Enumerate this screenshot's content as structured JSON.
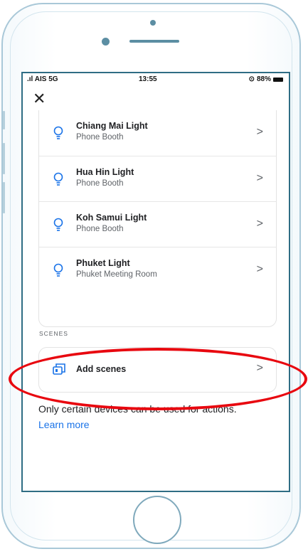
{
  "status_bar": {
    "carrier": ".ıl AIS 5G",
    "time": "13:55",
    "battery": "88%"
  },
  "header": {
    "close_glyph": "✕"
  },
  "devices": [
    {
      "name": "Chiang Mai Light",
      "room": "Phone Booth",
      "icon": "lightbulb-icon"
    },
    {
      "name": "Hua Hin Light",
      "room": "Phone Booth",
      "icon": "lightbulb-icon"
    },
    {
      "name": "Koh Samui Light",
      "room": "Phone Booth",
      "icon": "lightbulb-icon"
    },
    {
      "name": "Phuket Light",
      "room": "Phuket Meeting Room",
      "icon": "lightbulb-icon"
    }
  ],
  "scenes": {
    "section_label": "SCENES",
    "add_label": "Add scenes",
    "icon": "scenes-icon"
  },
  "chevron_glyph": ">",
  "footer": {
    "info": "Only certain devices can be used for actions.",
    "learn_more": "Learn more"
  },
  "colors": {
    "accent": "#1a73e8",
    "icon": "#1a73e8",
    "highlight": "#e8070f",
    "phone_frame": "#a9c8d8",
    "screen_border": "#2f6d84"
  }
}
